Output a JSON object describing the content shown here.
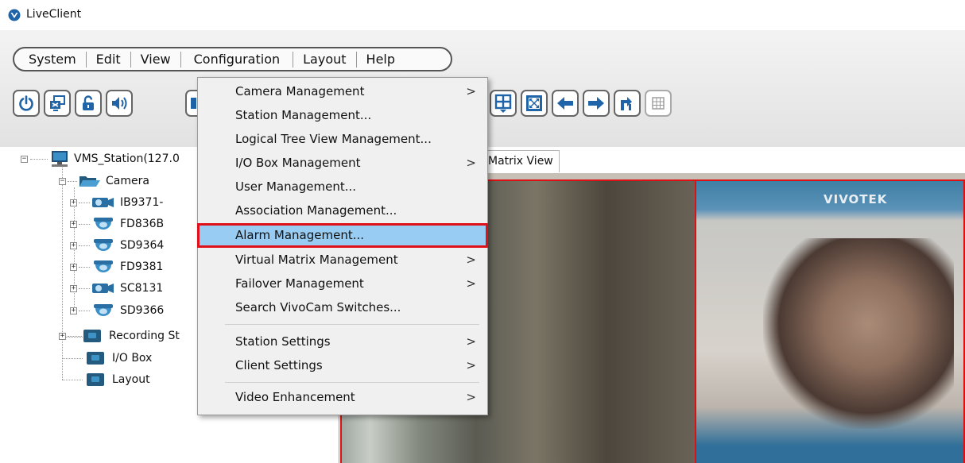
{
  "window": {
    "title": "LiveClient",
    "logo_icon": "vivotek-v-icon"
  },
  "menubar": {
    "items": [
      "System",
      "Edit",
      "View",
      "Configuration",
      "Layout",
      "Help"
    ]
  },
  "toolbar": {
    "buttons": [
      "power-icon",
      "monitor-icon",
      "lock-icon",
      "speaker-icon",
      "grid-icon",
      "fullscreen-icon",
      "arrow-left-icon",
      "arrow-right-icon",
      "return-icon",
      "matrix-icon"
    ]
  },
  "tree": {
    "station": "VMS_Station(127.0",
    "camera_folder": "Camera",
    "cameras": [
      "IB9371-",
      "FD836B",
      "SD9364",
      "FD9381",
      "SC8131",
      "SD9366"
    ],
    "recording": "Recording St",
    "io_box": "I/O Box",
    "layout": "Layout"
  },
  "tab": {
    "label": "Matrix View"
  },
  "video": {
    "logo": "VIVOTEK"
  },
  "context_menu": {
    "items": [
      {
        "label": "Camera Management",
        "submenu": true
      },
      {
        "label": "Station Management...",
        "submenu": false
      },
      {
        "label": "Logical Tree View Management...",
        "submenu": false
      },
      {
        "label": "I/O Box Management",
        "submenu": true
      },
      {
        "label": "User Management...",
        "submenu": false
      },
      {
        "label": "Association Management...",
        "submenu": false
      },
      {
        "label": "Alarm Management...",
        "submenu": false,
        "highlighted": true
      },
      {
        "label": "Virtual Matrix Management",
        "submenu": true
      },
      {
        "label": "Failover Management",
        "submenu": true
      },
      {
        "label": "Search VivoCam Switches...",
        "submenu": false
      },
      {
        "label": "Station Settings",
        "submenu": true
      },
      {
        "label": "Client Settings",
        "submenu": true
      },
      {
        "label": "Video Enhancement",
        "submenu": true
      }
    ],
    "arrow_glyph": ">"
  },
  "colors": {
    "highlight_bg": "#99ccf3",
    "highlight_border": "#e0101a",
    "toolbar_blue": "#1f63a8"
  }
}
